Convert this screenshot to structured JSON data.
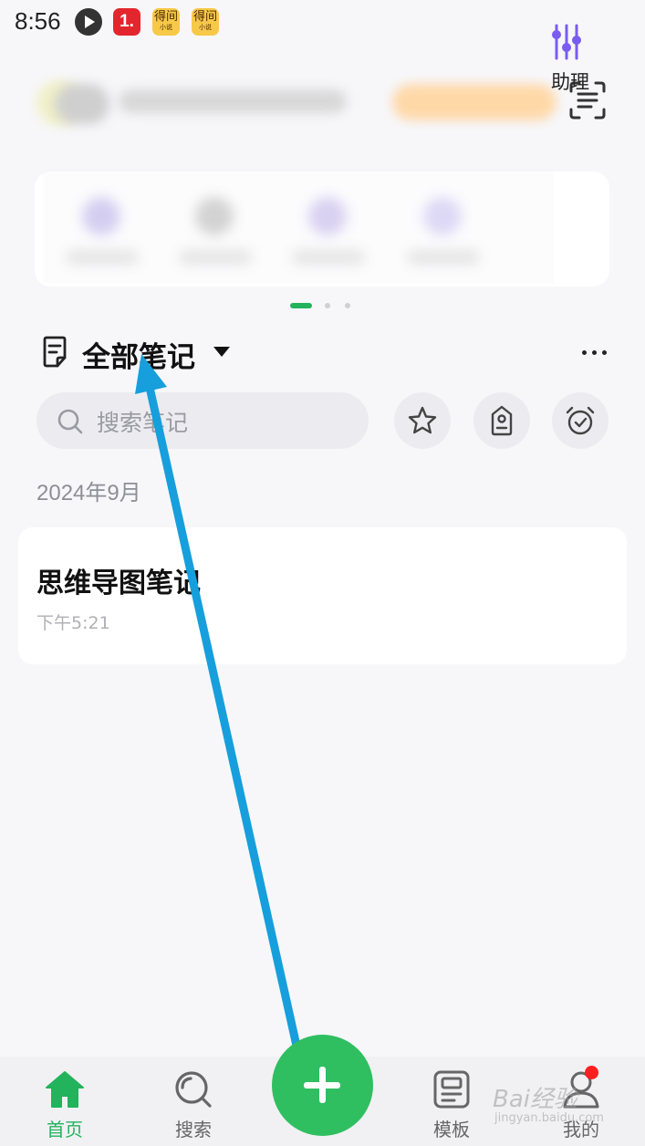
{
  "status_bar": {
    "time": "8:56",
    "app_icons": [
      "play-app-icon",
      "number-one-app-icon",
      "novel-app-icon",
      "novel-app-icon"
    ],
    "novel_icon_text": "得间",
    "novel_icon_sub": "小说",
    "number_one_text": "1."
  },
  "features": {
    "visible_label": "助理"
  },
  "notes": {
    "title": "全部笔记",
    "search_placeholder": "搜索笔记",
    "month": "2024年9月",
    "items": [
      {
        "title": "思维导图笔记",
        "time": "下午5:21"
      }
    ]
  },
  "bottom_nav": {
    "home": "首页",
    "search": "搜索",
    "template": "模板",
    "mine": "我的"
  },
  "watermark": {
    "text": "Bai经验",
    "sub": "jingyan.baidu.com"
  },
  "colors": {
    "accent": "#22b35c",
    "add_button": "#2fbf60",
    "annotation_arrow": "#169fdc",
    "badge": "#ff1f1f"
  }
}
